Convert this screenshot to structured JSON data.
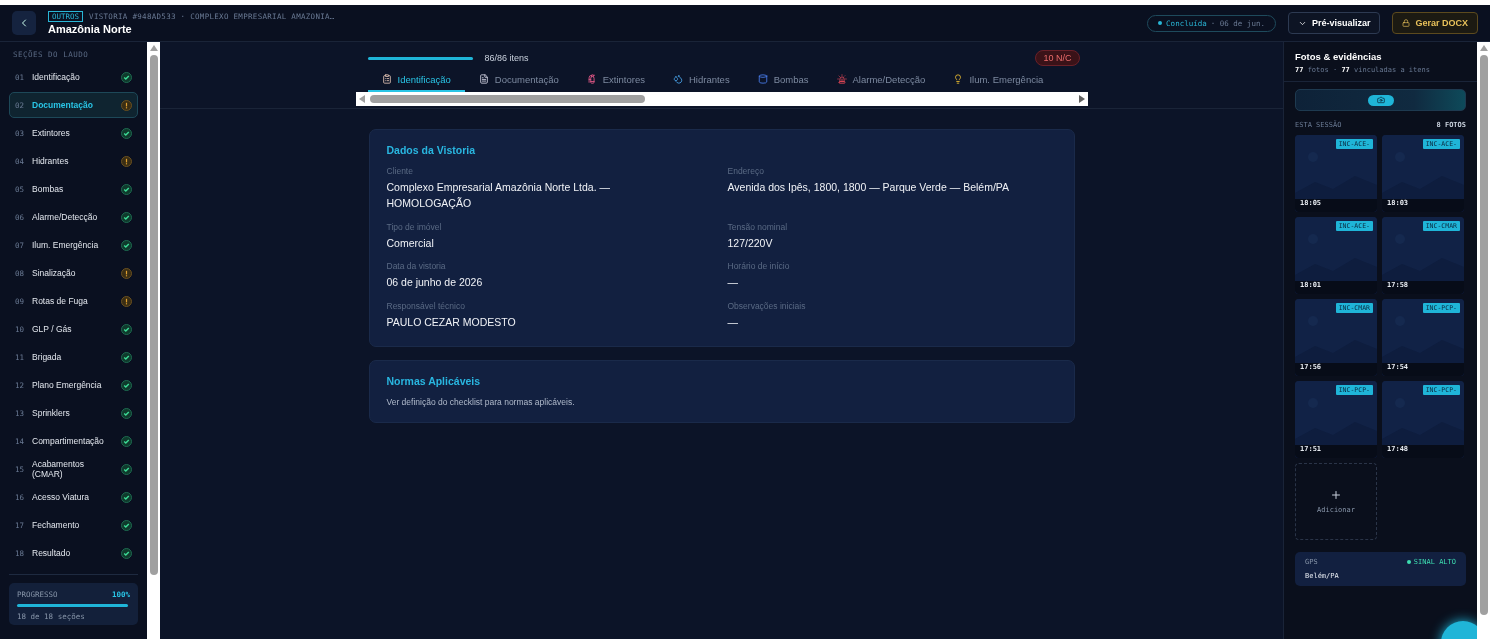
{
  "header": {
    "category": "OUTROS",
    "breadcrumb": "VISTORIA #948AD533 · COMPLEXO EMPRESARIAL AMAZONIA…",
    "title": "Amazônia Norte",
    "status": "Concluída",
    "date": "· 06 de jun.",
    "preview_button": "Pré-visualizar",
    "generate_button": "Gerar DOCX"
  },
  "sidebar": {
    "heading": "SEÇÕES DO LAUDO",
    "items": [
      {
        "number": "01",
        "label": "Identificação",
        "kind": "done",
        "selected": false
      },
      {
        "number": "02",
        "label": "Documentação",
        "kind": "pending",
        "selected": true
      },
      {
        "number": "03",
        "label": "Extintores",
        "kind": "done",
        "selected": false
      },
      {
        "number": "04",
        "label": "Hidrantes",
        "kind": "pending",
        "selected": false
      },
      {
        "number": "05",
        "label": "Bombas",
        "kind": "done",
        "selected": false
      },
      {
        "number": "06",
        "label": "Alarme/Detecção",
        "kind": "done",
        "selected": false
      },
      {
        "number": "07",
        "label": "Ilum. Emergência",
        "kind": "done",
        "selected": false
      },
      {
        "number": "08",
        "label": "Sinalização",
        "kind": "pending",
        "selected": false
      },
      {
        "number": "09",
        "label": "Rotas de Fuga",
        "kind": "pending",
        "selected": false
      },
      {
        "number": "10",
        "label": "GLP / Gás",
        "kind": "done",
        "selected": false
      },
      {
        "number": "11",
        "label": "Brigada",
        "kind": "done",
        "selected": false
      },
      {
        "number": "12",
        "label": "Plano Emergência",
        "kind": "done",
        "selected": false
      },
      {
        "number": "13",
        "label": "Sprinklers",
        "kind": "done",
        "selected": false
      },
      {
        "number": "14",
        "label": "Compartimentação",
        "kind": "done",
        "selected": false
      },
      {
        "number": "15",
        "label": "Acabamentos (CMAR)",
        "kind": "done",
        "selected": false
      },
      {
        "number": "16",
        "label": "Acesso Viatura",
        "kind": "done",
        "selected": false
      },
      {
        "number": "17",
        "label": "Fechamento",
        "kind": "done",
        "selected": false
      },
      {
        "number": "18",
        "label": "Resultado",
        "kind": "done",
        "selected": false
      }
    ],
    "progress": {
      "label": "PROGRESSO",
      "value": "100%",
      "level": 1,
      "caption": "18 de 18 seções"
    }
  },
  "main": {
    "progress": {
      "level": 1,
      "text": "86/86 itens"
    },
    "nc_badge": "10 N/C",
    "tabs": [
      {
        "kind": "clipboard",
        "label": "Identificação",
        "selected": true
      },
      {
        "kind": "document",
        "label": "Documentação",
        "selected": false
      },
      {
        "kind": "extinguisher",
        "label": "Extintores",
        "selected": false
      },
      {
        "kind": "hydrant",
        "label": "Hidrantes",
        "selected": false
      },
      {
        "kind": "pump",
        "label": "Bombas",
        "selected": false
      },
      {
        "kind": "alarm",
        "label": "Alarme/Detecção",
        "selected": false
      },
      {
        "kind": "bulb",
        "label": "Ilum. Emergência",
        "selected": false
      }
    ],
    "cards": [
      {
        "title": "Dados da Vistoria",
        "fields": [
          {
            "label": "Cliente",
            "value": "Complexo Empresarial Amazônia Norte Ltda. — HOMOLOGAÇÃO"
          },
          {
            "label": "Endereço",
            "value": "Avenida dos Ipês, 1800, 1800 — Parque Verde — Belém/PA"
          },
          {
            "label": "Tipo de imóvel",
            "value": "Comercial"
          },
          {
            "label": "Tensão nominal",
            "value": "127/220V"
          },
          {
            "label": "Data da vistoria",
            "value": "06 de junho de 2026"
          },
          {
            "label": "Horário de início",
            "value": "—"
          },
          {
            "label": "Responsável técnico",
            "value": "PAULO CEZAR MODESTO"
          },
          {
            "label": "Observações iniciais",
            "value": "—"
          }
        ]
      },
      {
        "title": "Normas Aplicáveis",
        "text": "Ver definição do checklist para normas aplicáveis."
      }
    ]
  },
  "photos_panel": {
    "title": "Fotos & evidências",
    "count": "77",
    "count_label": "fotos ·",
    "linked": "77",
    "linked_label": "vinculadas a itens",
    "session_label": "ESTA SESSÃO",
    "session_count": "8 FOTOS",
    "photos": [
      {
        "tag": "INC-ACE-",
        "time": "18:05"
      },
      {
        "tag": "INC-ACE-",
        "time": "18:03"
      },
      {
        "tag": "INC-ACE-",
        "time": "18:01"
      },
      {
        "tag": "INC-CMAR",
        "time": "17:58"
      },
      {
        "tag": "INC-CMAR",
        "time": "17:56"
      },
      {
        "tag": "INC-PCP-",
        "time": "17:54"
      },
      {
        "tag": "INC-PCP-",
        "time": "17:51"
      },
      {
        "tag": "INC-PCP-",
        "time": "17:48"
      }
    ],
    "add_label": "Adicionar",
    "gps": {
      "label": "GPS",
      "signal": "SINAL ALTO",
      "place": "Belém/PA"
    }
  }
}
